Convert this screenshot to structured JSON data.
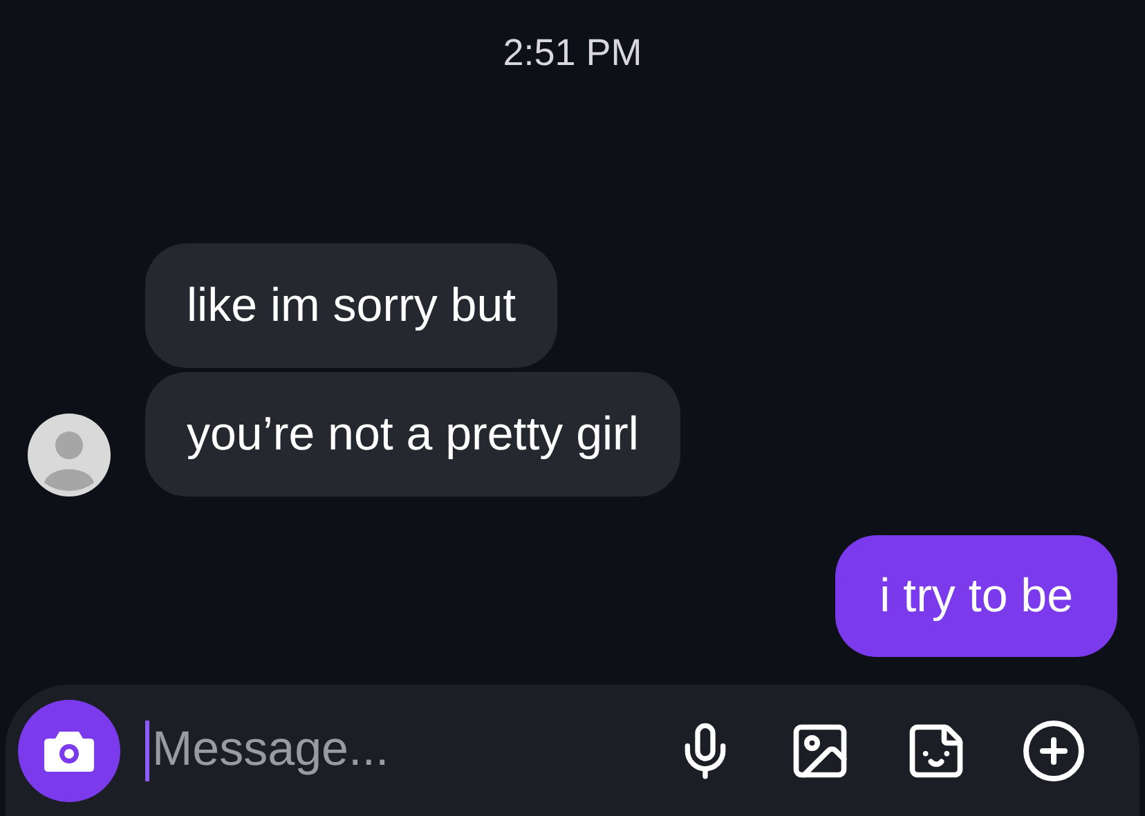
{
  "time": "2:51 PM",
  "messages": [
    {
      "kind": "received",
      "text": "like im sorry but",
      "avatar": false
    },
    {
      "kind": "received",
      "text": "you’re not a pretty girl",
      "avatar": true
    },
    {
      "kind": "sent",
      "text": "i try to be"
    }
  ],
  "composer": {
    "placeholder": "Message..."
  }
}
